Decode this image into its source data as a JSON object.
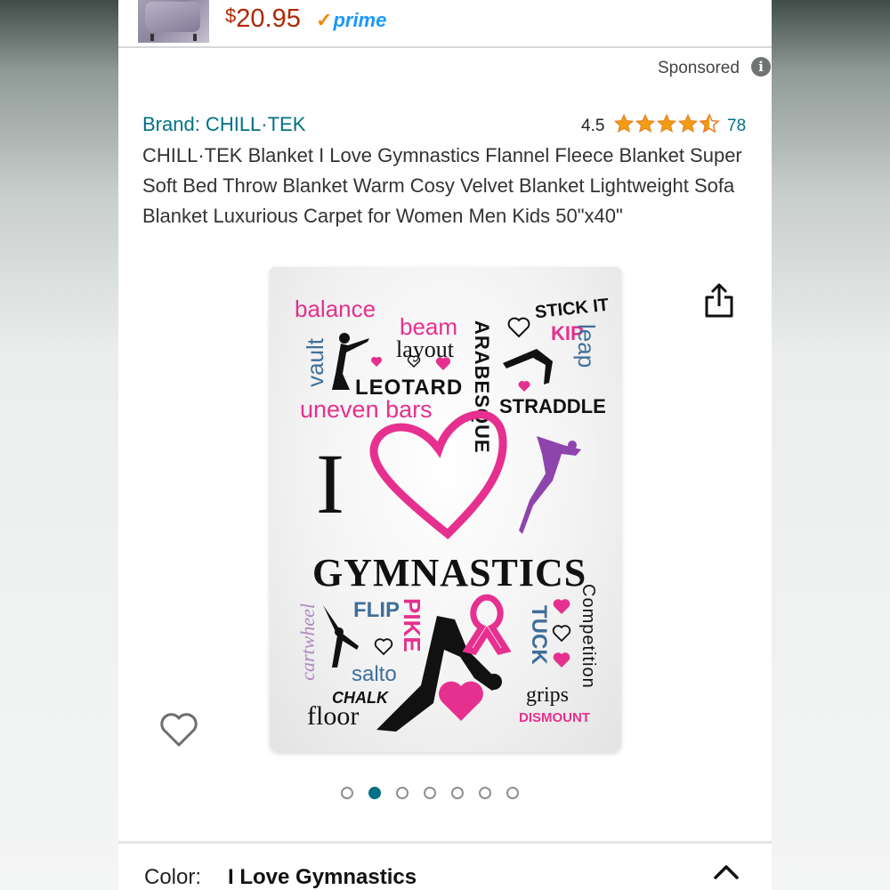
{
  "top_strip": {
    "price": "20.95",
    "currency": "$",
    "prime_label": "prime"
  },
  "sponsored": "Sponsored",
  "product": {
    "brand": "Brand: CHILL·TEK",
    "rating": "4.5",
    "rating_value": 4.5,
    "review_count": "78",
    "title": "CHILL·TEK Blanket I Love Gymnastics Flannel Fleece Blanket Super Soft Bed Throw Blanket Warm Cosy Velvet Blanket Lightweight Sofa Blanket Luxurious Carpet for Women Men Kids 50\"x40\""
  },
  "image_words": {
    "balance": "balance",
    "beam": "beam",
    "layout": "layout",
    "arabesque": "ARABESQUE",
    "stick_it": "STICK IT",
    "kip": "KIP",
    "leap": "leap",
    "vault": "vault",
    "leotard": "LEOTARD",
    "uneven_bars": "uneven bars",
    "straddle": "STRADDLE",
    "i": "I",
    "gymnastics": "GYMNASTICS",
    "flip": "FLIP",
    "pike": "PIKE",
    "tuck": "TUCK",
    "competition": "Competition",
    "cartwheel": "cartwheel",
    "salto": "salto",
    "chalk": "CHALK",
    "floor": "floor",
    "grips": "grips",
    "dismount": "DISMOUNT"
  },
  "carousel": {
    "dot_count": 7,
    "active_index": 1
  },
  "color_selector": {
    "label": "Color:",
    "value": "I Love Gymnastics"
  },
  "colors": {
    "link": "#007185",
    "price": "#b12704",
    "prime": "#1a98ff",
    "star": "#f39c12",
    "pink": "#e6308f"
  },
  "icons": [
    "info-icon",
    "star-icon",
    "share-icon",
    "heart-icon",
    "chevron-up-icon",
    "prime-check-icon"
  ]
}
